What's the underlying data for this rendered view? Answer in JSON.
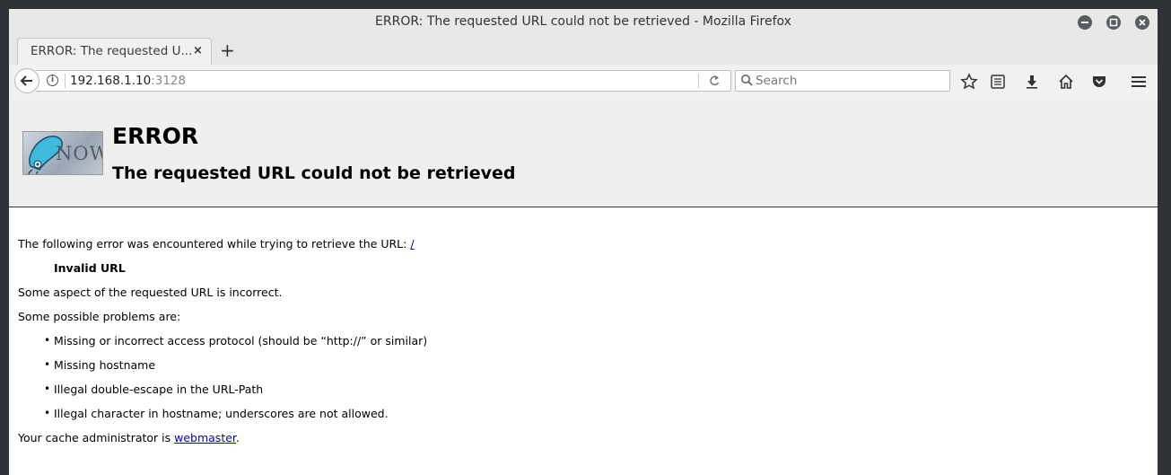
{
  "window": {
    "title": "ERROR: The requested URL could not be retrieved - Mozilla Firefox",
    "controls": [
      "minimize",
      "maximize",
      "close"
    ]
  },
  "tabs": [
    {
      "label": "ERROR: The requested U...",
      "close": "×"
    }
  ],
  "new_tab_label": "+",
  "navbar": {
    "url_host": "192.168.1.10",
    "url_port": ":3128",
    "search_placeholder": "Search",
    "icons": [
      "bookmark-star-icon",
      "reading-list-icon",
      "downloads-icon",
      "home-icon",
      "pocket-icon",
      "menu-icon"
    ]
  },
  "page": {
    "logo_text": "NOW",
    "title": "ERROR",
    "subtitle": "The requested URL could not be retrieved",
    "intro": "The following error was encountered while trying to retrieve the URL: ",
    "intro_link": "/",
    "error_name": "Invalid URL",
    "description": "Some aspect of the requested URL is incorrect.",
    "problems_heading": "Some possible problems are:",
    "problems": [
      "Missing or incorrect access protocol (should be “http://” or similar)",
      "Missing hostname",
      "Illegal double-escape in the URL-Path",
      "Illegal character in hostname; underscores are not allowed."
    ],
    "admin_prefix": "Your cache administrator is ",
    "admin_link": "webmaster",
    "admin_suffix": "."
  },
  "colors": {
    "link": "#0000cc",
    "header_bg": "#efefef",
    "chrome_bg": "#e8e8e7"
  }
}
